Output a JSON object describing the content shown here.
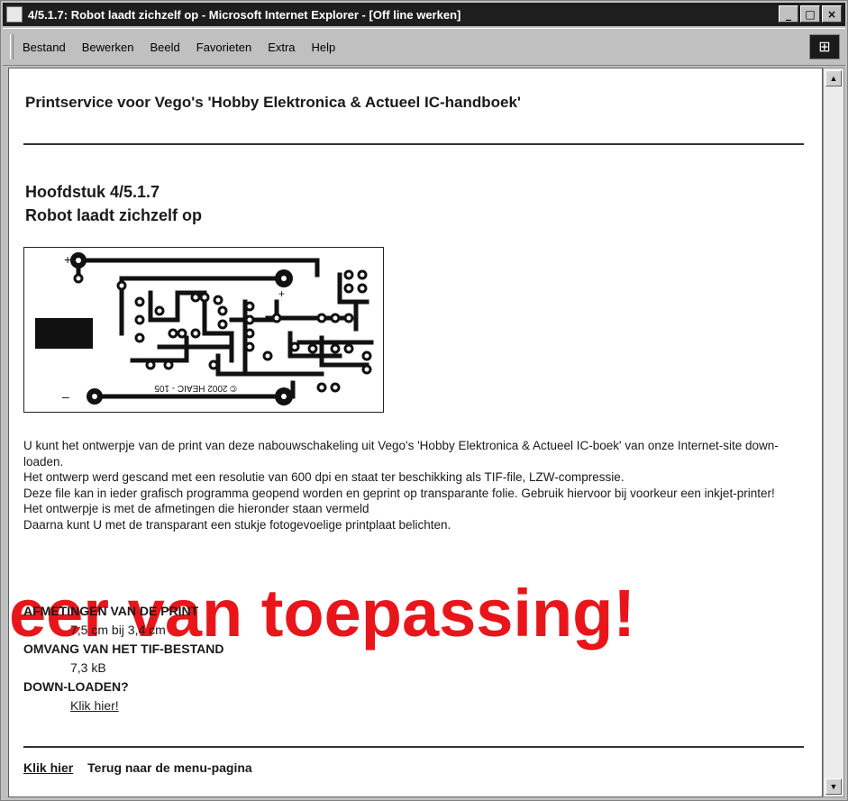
{
  "window": {
    "title": "4/5.1.7: Robot laadt zichzelf op - Microsoft Internet Explorer - [Off line werken]",
    "controls": {
      "minimize": "_",
      "maximize": "□",
      "close": "×"
    }
  },
  "menubar": {
    "items": [
      "Bestand",
      "Bewerken",
      "Beeld",
      "Favorieten",
      "Extra",
      "Help"
    ]
  },
  "page": {
    "header": "Printservice voor Vego's 'Hobby Elektronica & Actueel IC-handboek'",
    "chapter_number": "Hoofdstuk 4/5.1.7",
    "chapter_title": "Robot laadt zichzelf op",
    "pcb_label": "© 2002 HEAIC - 105",
    "paragraphs": [
      "U kunt het ontwerpje van de print van deze nabouwschakeling uit Vego's 'Hobby Elektronica & Actueel IC-boek' van onze Internet-site down-loaden.",
      "Het ontwerp werd gescand met een resolutie van 600 dpi en staat ter beschikking als TIF-file, LZW-compressie.",
      "Deze file kan in ieder grafisch programma geopend worden en geprint op transparante folie. Gebruik hiervoor bij voorkeur een inkjet-printer!",
      "Het ontwerpje is met de afmetingen die hieronder staan vermeld",
      "Daarna kunt U met de transparant een stukje fotogevoelige printplaat belichten."
    ],
    "watermark": "eer van toepassing!",
    "specs": [
      {
        "label": "AFMETINGEN VAN DE PRINT",
        "value": "7,5 cm bij 3,4 cm"
      },
      {
        "label": "OMVANG VAN HET TIF-BESTAND",
        "value": "7,3 kB"
      },
      {
        "label": "DOWN-LOADEN?",
        "link": "Klik hier!"
      }
    ],
    "footer": {
      "link": "Klik hier",
      "text": "Terug naar de menu-pagina"
    }
  }
}
